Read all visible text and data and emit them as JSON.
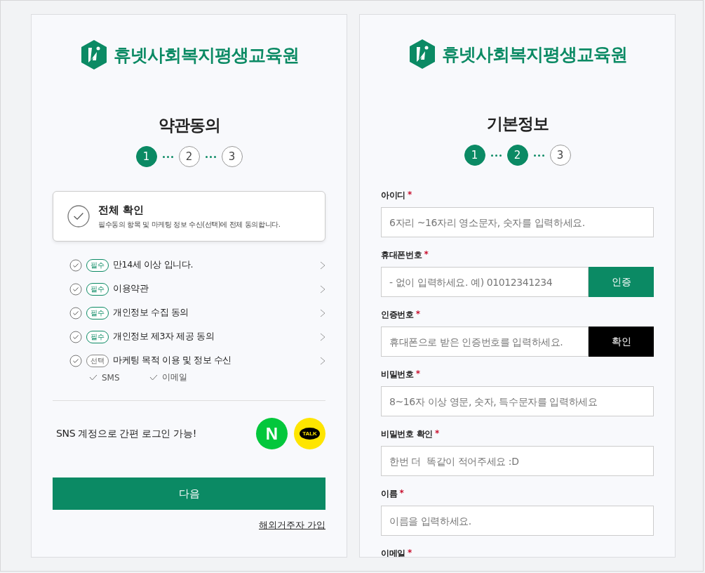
{
  "terms_panel": {
    "logo_text": "휴넷사회복지평생교육원",
    "title": "약관동의",
    "steps": [
      {
        "label": "1",
        "active": true
      },
      {
        "label": "2",
        "active": false
      },
      {
        "label": "3",
        "active": false
      }
    ],
    "agree_all": {
      "title": "전체 확인",
      "description": "필수동의 항목 및 마케팅 정보 수신(선택)에 전체 동의합니다.",
      "checked": false
    },
    "terms": [
      {
        "tag": "필수",
        "required": true,
        "label": "만14세 이상 입니다.",
        "checked": false
      },
      {
        "tag": "필수",
        "required": true,
        "label": "이용약관",
        "checked": false
      },
      {
        "tag": "필수",
        "required": true,
        "label": "개인정보 수집 동의",
        "checked": false
      },
      {
        "tag": "필수",
        "required": true,
        "label": "개인정보 제3자 제공 동의",
        "checked": false
      },
      {
        "tag": "선택",
        "required": false,
        "label": "마케팅 목적 이용 및 정보 수신",
        "checked": false
      }
    ],
    "channels": [
      {
        "label": "SMS",
        "checked": false
      },
      {
        "label": "이메일",
        "checked": false
      }
    ],
    "sns_text": "SNS 계정으로 간편 로그인 가능!",
    "sns_buttons": [
      {
        "kind": "naver",
        "label": "N"
      },
      {
        "kind": "kakao",
        "label": "TALK"
      }
    ],
    "next_button": "다음",
    "overseas_link": "해외거주자 가입"
  },
  "info_panel": {
    "logo_text": "휴넷사회복지평생교육원",
    "title": "기본정보",
    "steps": [
      {
        "label": "1",
        "active": true
      },
      {
        "label": "2",
        "active": true
      },
      {
        "label": "3",
        "active": false
      }
    ],
    "fields": [
      {
        "label": "아이디",
        "required_mark": "*",
        "placeholder": "6자리 ~16자리 영소문자, 숫자를 입력하세요."
      },
      {
        "label": "휴대폰번호",
        "required_mark": "*",
        "placeholder": "- 없이 입력하세요. 예) 01012341234",
        "button": {
          "label": "인증",
          "kind": "primary"
        }
      },
      {
        "label": "인증번호",
        "required_mark": "*",
        "placeholder": "휴대폰으로 받은 인증번호를 입력하세요.",
        "button": {
          "label": "확인",
          "kind": "dark"
        }
      },
      {
        "label": "비밀번호",
        "required_mark": "*",
        "placeholder": "8~16자 이상 영문, 숫자, 특수문자를 입력하세요"
      },
      {
        "label": "비밀번호 확인",
        "required_mark": "*",
        "placeholder": "한번 더  똑같이 적어주세요 :D"
      },
      {
        "label": "이름",
        "required_mark": "*",
        "placeholder": "이름을 입력하세요."
      },
      {
        "label": "이메일",
        "required_mark": "*"
      }
    ]
  }
}
